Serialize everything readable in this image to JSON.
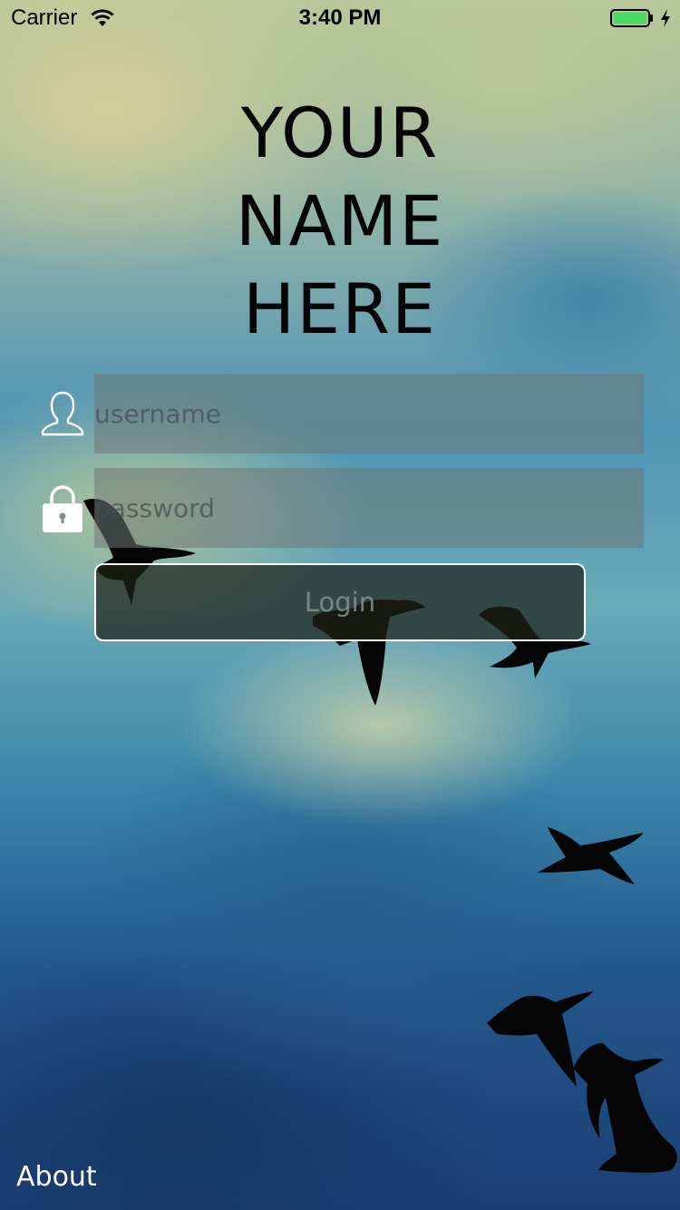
{
  "status_bar": {
    "carrier": "Carrier",
    "time": "3:40 PM",
    "battery_color": "#4cd964"
  },
  "title": {
    "line1": "YOUR",
    "line2": "NAME",
    "line3": "HERE"
  },
  "form": {
    "username_placeholder": "username",
    "username_value": "",
    "username_icon": "user-icon",
    "password_placeholder": "password",
    "password_value": "",
    "password_icon": "lock-icon",
    "login_label": "Login"
  },
  "footer": {
    "about_label": "About"
  },
  "background": "sky-with-flying-geese"
}
